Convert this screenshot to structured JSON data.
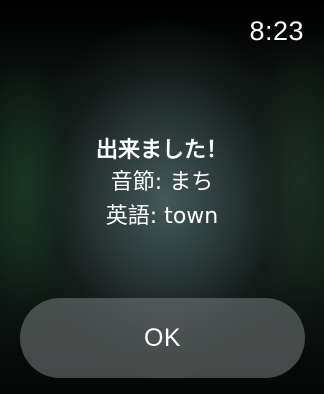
{
  "status_bar": {
    "time": "8:23"
  },
  "alert": {
    "title": "出来ました！",
    "syllable_line": "音節: まち",
    "english_line": "英語: town",
    "ok_label": "OK"
  },
  "colors": {
    "text": "#ffffff",
    "button_bg": "#787e7e"
  }
}
